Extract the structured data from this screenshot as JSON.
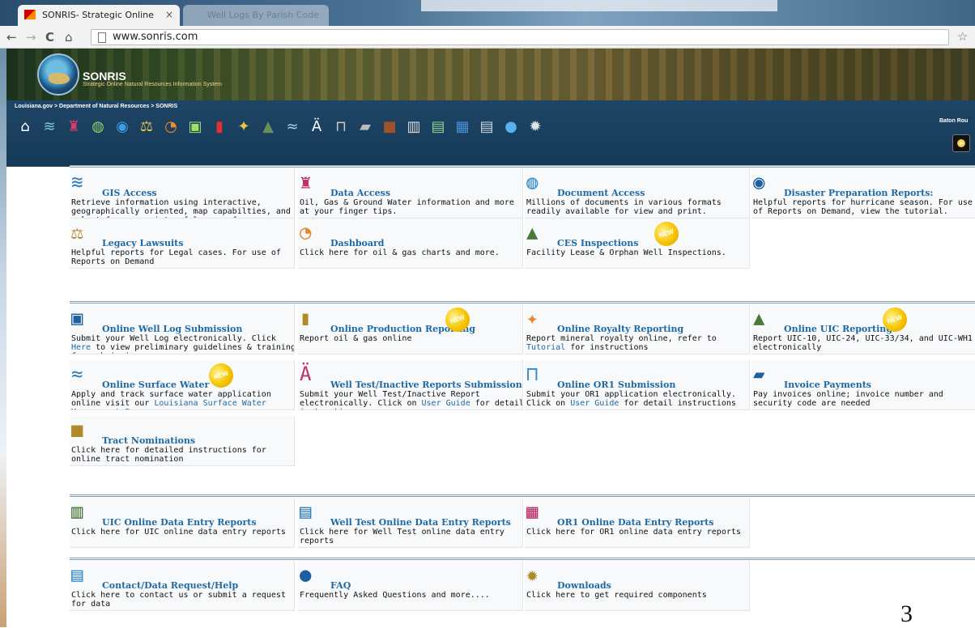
{
  "browser": {
    "tab_active": "SONRIS- Strategic Online",
    "tab_close": "×",
    "tab_inactive": "Well Logs By Parish Code",
    "url": "www.sonris.com",
    "nav_back": "←",
    "nav_forward": "→",
    "nav_reload": "C",
    "nav_home": "⌂",
    "bookmark": "☆"
  },
  "header": {
    "site_name": "SONRIS",
    "tagline": "Strategic Online Natural Resources Information System",
    "breadcrumb": "Louisiana.gov > Department of Natural Resources > SONRIS",
    "location": "Baton Rou"
  },
  "nav_icons": [
    "home-icon",
    "layers-icon",
    "oil-derrick-icon",
    "document-globe-icon",
    "hurricane-icon",
    "scales-icon",
    "pie-chart-icon",
    "monitor-icon",
    "barrel-icon",
    "coins-icon",
    "well-icon",
    "water-icon",
    "wellhead-icon",
    "gate-icon",
    "card-icon",
    "box-icon",
    "disk-icon",
    "chart-icon",
    "blocks-icon",
    "contact-card-icon",
    "faq-icon",
    "gear-icon"
  ],
  "nav_glyphs": [
    "⌂",
    "≋",
    "♜",
    "◍",
    "◉",
    "⚖",
    "◔",
    "▣",
    "▮",
    "✦",
    "▲",
    "≈",
    "Ä",
    "⊓",
    "▰",
    "■",
    "▥",
    "▤",
    "▦",
    "▤",
    "●",
    "✹"
  ],
  "sections": [
    {
      "cells": [
        {
          "icon": "map-layers-icon",
          "glyph": "≋",
          "title": "GIS Access",
          "desc": "Retrieve information using interactive, geographically oriented, map capabilties, and select from a variety of layers of backgrounds."
        },
        {
          "icon": "data-access-icon",
          "glyph": "♜",
          "title": "Data Access",
          "desc": "Oil, Gas & Ground Water information and more at your finger tips."
        },
        {
          "icon": "document-globe-icon",
          "glyph": "◍",
          "title": "Document Access",
          "desc": "Millions of documents in various formats readily available for view and print."
        },
        {
          "icon": "hurricane-icon",
          "glyph": "◉",
          "title": "Disaster Preparation Reports:",
          "desc": "Helpful reports for hurricane season. For use of Reports on Demand, view the tutorial."
        },
        {
          "icon": "scales-icon",
          "glyph": "⚖",
          "title": "Legacy Lawsuits",
          "desc": "Helpful reports for Legal cases. For use of Reports on Demand"
        },
        {
          "icon": "pie-chart-icon",
          "glyph": "◔",
          "title": "Dashboard",
          "desc": "Click here for oil & gas charts and more."
        },
        {
          "icon": "ces-inspection-icon",
          "glyph": "▲",
          "title": "CES Inspections",
          "desc": "Facility Lease & Orphan Well Inspections.",
          "badge": "NEW"
        }
      ]
    },
    {
      "cells": [
        {
          "icon": "well-log-monitor-icon",
          "glyph": "▣",
          "title": "Online Well Log Submission",
          "desc_pre": "Submit your Well Log electronically. Click ",
          "link": "Here",
          "desc_post": " to view preliminary guidelines & training for submission."
        },
        {
          "icon": "barrel-icon",
          "glyph": "▮",
          "title": "Online Production Reporting",
          "desc": "Report oil & gas online",
          "badge": "NEW"
        },
        {
          "icon": "coins-icon",
          "glyph": "✦",
          "title": "Online Royalty Reporting",
          "desc_pre": "Report mineral royalty online, refer to ",
          "link": "Tutorial",
          "desc_post": " for instructions"
        },
        {
          "icon": "uic-well-icon",
          "glyph": "▲",
          "title": "Online UIC Reporting",
          "desc": "Report UIC-10, UIC-24, UIC-33/34, and UIC-WH1 electronically",
          "badge": "NEW"
        },
        {
          "icon": "surface-water-icon",
          "glyph": "≈",
          "title": "Online Surface Water",
          "desc_pre": "Apply and track surface water application online visit our ",
          "link": "Louisiana Surface Water Management Program",
          "desc_post": "",
          "badge": "NEW"
        },
        {
          "icon": "wellhead-icon",
          "glyph": "Ä",
          "title": "Well Test/Inactive Reports Submission",
          "desc_pre": "Submit your Well Test/Inactive Report electronically. Click on ",
          "link": "User Guide",
          "desc_post": " for detail instructions"
        },
        {
          "icon": "gate-icon",
          "glyph": "⊓",
          "title": "Online OR1 Submission",
          "desc_pre": "Submit your OR1 application electronically. Click on ",
          "link": "User Guide",
          "desc_post": " for detail instructions"
        },
        {
          "icon": "payment-terminal-icon",
          "glyph": "▰",
          "title": "Invoice Payments",
          "desc": "Pay invoices online; invoice number and security code are needed"
        },
        {
          "icon": "tract-box-icon",
          "glyph": "■",
          "title": "Tract Nominations",
          "desc": "Click here for detailed instructions for online tract nomination"
        }
      ]
    },
    {
      "cells": [
        {
          "icon": "disk-drive-icon",
          "glyph": "▥",
          "title": "UIC Online Data Entry Reports",
          "desc": "Click here for UIC online data entry reports"
        },
        {
          "icon": "bar-chart-icon",
          "glyph": "▤",
          "title": "Well Test Online Data Entry Reports",
          "desc": "Click here for Well Test online data entry reports"
        },
        {
          "icon": "blocks-icon",
          "glyph": "▦",
          "title": "OR1 Online Data Entry Reports",
          "desc": "Click here for OR1 online data entry reports"
        }
      ]
    },
    {
      "cells": [
        {
          "icon": "contact-card-icon",
          "glyph": "▤",
          "title": "Contact/Data Request/Help",
          "desc": "Click here to contact us or submit a request for data"
        },
        {
          "icon": "faq-bubble-icon",
          "glyph": "●",
          "title": "FAQ",
          "desc": "Frequently Asked Questions and more...."
        },
        {
          "icon": "gear-icon",
          "glyph": "✹",
          "title": "Downloads",
          "desc": "Click here to get required components"
        }
      ]
    }
  ],
  "page_number": "3"
}
